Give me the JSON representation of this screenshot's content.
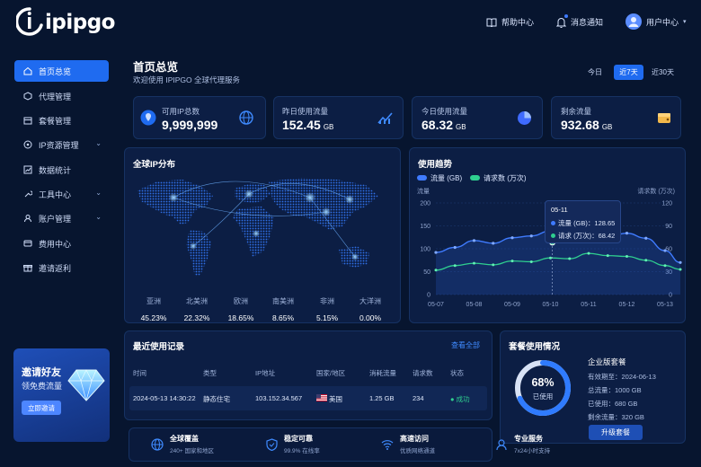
{
  "brand": {
    "logo": "ipipgo"
  },
  "top": {
    "help": "帮助中心",
    "notify": "消息通知",
    "user": "用户中心"
  },
  "sidebar": {
    "items": [
      {
        "label": "首页总览",
        "icon": "home-icon",
        "active": true
      },
      {
        "label": "代理管理",
        "icon": "proxy-icon"
      },
      {
        "label": "套餐管理",
        "icon": "package-icon"
      },
      {
        "label": "IP资源管理",
        "icon": "server-icon",
        "chevron": true
      },
      {
        "label": "数据统计",
        "icon": "chart-icon"
      },
      {
        "label": "工具中心",
        "icon": "tool-icon",
        "chevron": true
      },
      {
        "label": "账户管理",
        "icon": "user-icon",
        "chevron": true
      },
      {
        "label": "费用中心",
        "icon": "bill-icon"
      },
      {
        "label": "邀请返利",
        "icon": "gift-icon"
      }
    ],
    "invite": {
      "title": "邀请好友",
      "subtitle": "领免费流量",
      "button": "立即邀请"
    }
  },
  "header": {
    "title": "首页总览",
    "subtitle": "欢迎使用 IPIPGO 全球代理服务",
    "tabs": [
      "今日",
      "近7天",
      "近30天"
    ],
    "active_tab": 1
  },
  "stats": [
    {
      "label": "可用IP总数",
      "value": "9,999,999",
      "unit": "",
      "icon": "globe-icon"
    },
    {
      "label": "昨日使用流量",
      "value": "152.45",
      "unit": "GB",
      "icon": "trend-icon"
    },
    {
      "label": "今日使用流量",
      "value": "68.32",
      "unit": "GB",
      "icon": "pie-icon"
    },
    {
      "label": "剩余流量",
      "value": "932.68",
      "unit": "GB",
      "icon": "wallet-icon"
    }
  ],
  "map": {
    "title": "全球IP分布",
    "regions": [
      {
        "name": "亚洲",
        "pct": "45.23%"
      },
      {
        "name": "北美洲",
        "pct": "22.32%"
      },
      {
        "name": "欧洲",
        "pct": "18.65%"
      },
      {
        "name": "南美洲",
        "pct": "8.65%"
      },
      {
        "name": "非洲",
        "pct": "5.15%"
      },
      {
        "name": "大洋洲",
        "pct": "0.00%"
      }
    ]
  },
  "trend": {
    "title": "使用趋势",
    "left_unit": "流量",
    "right_unit": "请求数 (万次)",
    "tooltip": {
      "date": "05-11",
      "flow_label": "流量 (GB)：128.65",
      "req_label": "请求 (万次)：68.42"
    }
  },
  "chart_data": {
    "type": "line",
    "x": [
      "05-07",
      "05-08",
      "05-09",
      "05-10",
      "05-11",
      "05-12",
      "05-13"
    ],
    "series": [
      {
        "name": "流量 (GB)",
        "axis": "left",
        "color": "#3f7bff",
        "values": [
          92,
          103,
          118,
          112,
          124,
          128,
          139,
          129,
          136,
          126,
          134,
          123,
          96,
          70
        ]
      },
      {
        "name": "请求数 (万次)",
        "axis": "right",
        "color": "#2fcf8f",
        "values": [
          32,
          38,
          41,
          39,
          44,
          43,
          48,
          47,
          54,
          51,
          50,
          45,
          38,
          33
        ]
      }
    ],
    "x_fractional_index": [
      0,
      0.5,
      1,
      1.5,
      2,
      2.5,
      3,
      3.5,
      4,
      4.5,
      5,
      5.5,
      6,
      6.4
    ],
    "y_left": {
      "range": [
        0,
        150
      ],
      "ticks": [
        "0",
        "50",
        "100",
        "150",
        "200"
      ]
    },
    "y_right": {
      "range": [
        0,
        120
      ],
      "ticks": [
        "0",
        "30",
        "60",
        "90",
        "120"
      ]
    },
    "legend_position": "top-left"
  },
  "records": {
    "title": "最近使用记录",
    "view_all": "查看全部",
    "columns": [
      "时间",
      "类型",
      "IP地址",
      "国家/地区",
      "消耗流量",
      "请求数",
      "状态"
    ],
    "rows": [
      [
        "2024-05-13 14:30:22",
        "静态住宅",
        "103.152.34.567",
        "美国",
        "1.25 GB",
        "234",
        "成功"
      ]
    ]
  },
  "package": {
    "title": "套餐使用情况",
    "percent": "68%",
    "used_label": "已使用",
    "used_fraction": 0.68,
    "name": "企业版套餐",
    "expiry": "有效期至：2024-06-13",
    "total": "总流量：1000 GB",
    "used": "已使用：680 GB",
    "remain": "剩余流量：320 GB",
    "button": "升级套餐"
  },
  "features": [
    {
      "title": "全球覆盖",
      "sub": "240+ 国家和地区",
      "icon": "globe-icon"
    },
    {
      "title": "稳定可靠",
      "sub": "99.9% 在线率",
      "icon": "shield-icon"
    },
    {
      "title": "高速访问",
      "sub": "优质网络通道",
      "icon": "wifi-icon"
    },
    {
      "title": "专业服务",
      "sub": "7x24小时支持",
      "icon": "headset-icon"
    }
  ],
  "colors": {
    "accent": "#1f6bf0",
    "success": "#2fcf8f",
    "bg": "#07152f",
    "panel": "#0c1e44"
  }
}
